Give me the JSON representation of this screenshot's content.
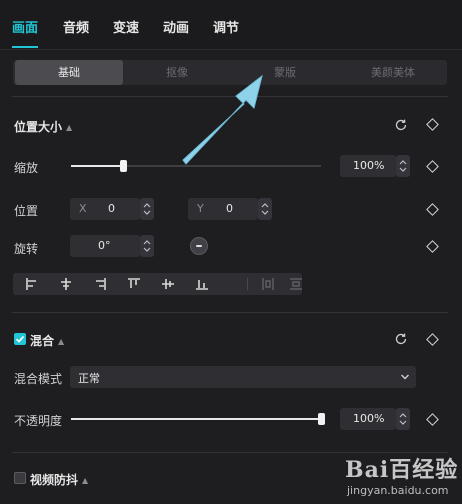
{
  "tabs": [
    {
      "label": "画面",
      "active": true
    },
    {
      "label": "音频",
      "active": false
    },
    {
      "label": "变速",
      "active": false
    },
    {
      "label": "动画",
      "active": false
    },
    {
      "label": "调节",
      "active": false
    }
  ],
  "subtabs": [
    {
      "label": "基础",
      "active": true
    },
    {
      "label": "抠像",
      "active": false
    },
    {
      "label": "蒙版",
      "active": false
    },
    {
      "label": "美颜美体",
      "active": false
    }
  ],
  "position_size": {
    "title": "位置大小",
    "scale_label": "缩放",
    "scale_value": "100%",
    "scale_fraction": 0.21,
    "position_label": "位置",
    "x_axis": "X",
    "x_value": "0",
    "y_axis": "Y",
    "y_value": "0",
    "rotate_label": "旋转",
    "rotate_value": "0°"
  },
  "blend": {
    "title": "混合",
    "checked": true,
    "mode_label": "混合模式",
    "mode_value": "正常",
    "opacity_label": "不透明度",
    "opacity_value": "100%",
    "opacity_fraction": 1.0
  },
  "stabilize": {
    "title": "视频防抖",
    "checked": false
  },
  "watermark": {
    "text": "Bai百经验",
    "sub": "jingyan.baidu.com"
  },
  "colors": {
    "accent": "#21c6d6",
    "arrow": "#8ed3ea"
  }
}
